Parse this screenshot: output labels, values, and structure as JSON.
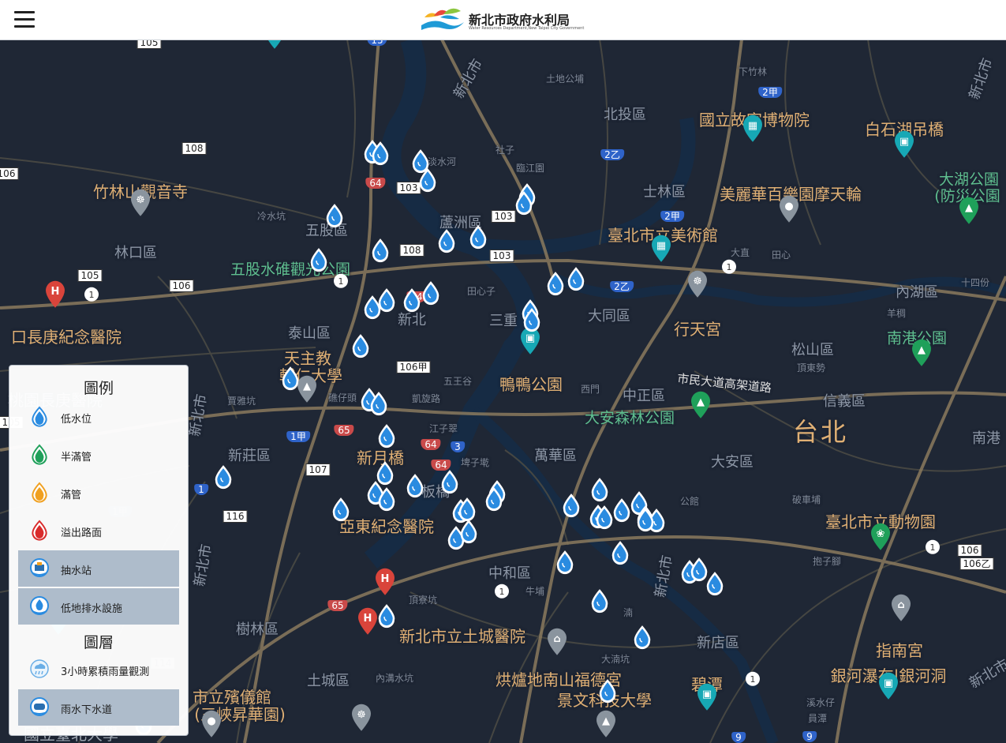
{
  "header": {
    "title": "新北市政府水利局",
    "subtitle": "Water Resources Department,New Taipei City Government"
  },
  "legend": {
    "title": "圖例",
    "items": [
      {
        "label": "低水位",
        "color": "#2a8be0",
        "active": false
      },
      {
        "label": "半滿管",
        "color": "#1fa05a",
        "active": false
      },
      {
        "label": "滿管",
        "color": "#f0a020",
        "active": false
      },
      {
        "label": "溢出路面",
        "color": "#d92b2b",
        "active": false
      },
      {
        "label": "抽水站",
        "color": "#2a8be0",
        "active": true
      },
      {
        "label": "低地排水設施",
        "color": "#2a8be0",
        "active": true
      }
    ],
    "layers_title": "圖層",
    "layers": [
      {
        "label": "3小時累積雨量觀測",
        "active": false
      },
      {
        "label": "雨水下水道",
        "active": true
      }
    ]
  },
  "map": {
    "places": [
      {
        "text": "竹林山觀音寺"
      },
      {
        "text": "口長庚紀念醫院"
      },
      {
        "text": "天主教"
      },
      {
        "text": "輔仁大學"
      },
      {
        "text": "桃園長庚醫院"
      },
      {
        "text": "新月橋"
      },
      {
        "text": "亞東紀念醫院"
      },
      {
        "text": "新北市立土城醫院"
      },
      {
        "text": "市立殯儀館"
      },
      {
        "text": "(三峽昇華園)"
      },
      {
        "text": "烘爐地南山福德宮"
      },
      {
        "text": "景文科技大學"
      },
      {
        "text": "碧潭"
      },
      {
        "text": "鴨鴨公園"
      },
      {
        "text": "國立故宮博物院"
      },
      {
        "text": "白石湖吊橋"
      },
      {
        "text": "美麗華百樂園摩天輪"
      },
      {
        "text": "臺北市立美術館"
      },
      {
        "text": "行天宮"
      },
      {
        "text": "臺北市立動物園"
      },
      {
        "text": "指南宮"
      },
      {
        "text": "銀河瀑布|銀河洞"
      },
      {
        "text": "國立臺北大學"
      },
      {
        "text": "市民大道高架道路"
      }
    ],
    "parks": [
      {
        "text": "五股水碓觀光公園"
      },
      {
        "text": "大安森林公園"
      },
      {
        "text": "南港公園"
      },
      {
        "text": "大湖公園"
      },
      {
        "text": "(防災公園"
      }
    ],
    "districts": [
      {
        "text": "蘆洲區"
      },
      {
        "text": "林口區"
      },
      {
        "text": "泰山區"
      },
      {
        "text": "新莊區"
      },
      {
        "text": "樹林區"
      },
      {
        "text": "土城區"
      },
      {
        "text": "中和區"
      },
      {
        "text": "萬華區"
      },
      {
        "text": "大同區"
      },
      {
        "text": "中正區"
      },
      {
        "text": "大安區"
      },
      {
        "text": "信義區"
      },
      {
        "text": "松山區"
      },
      {
        "text": "內湖區"
      },
      {
        "text": "士林區"
      },
      {
        "text": "北投區"
      },
      {
        "text": "新店區"
      },
      {
        "text": "五股區"
      },
      {
        "text": "三重"
      },
      {
        "text": "新北"
      },
      {
        "text": "板橋"
      },
      {
        "text": "新北市"
      },
      {
        "text": "南港"
      },
      {
        "text": "新北市"
      },
      {
        "text": "新北市"
      },
      {
        "text": "新北市"
      },
      {
        "text": "新北市"
      },
      {
        "text": "新北市"
      }
    ],
    "small_places": [
      {
        "text": "土地公埔"
      },
      {
        "text": "下竹林"
      },
      {
        "text": "淡水河"
      },
      {
        "text": "社子"
      },
      {
        "text": "臨江園"
      },
      {
        "text": "冷水坑"
      },
      {
        "text": "田心子"
      },
      {
        "text": "大直"
      },
      {
        "text": "田心"
      },
      {
        "text": "十四份"
      },
      {
        "text": "羊稠"
      },
      {
        "text": "頂東勢"
      },
      {
        "text": "五王谷"
      },
      {
        "text": "凱旋路"
      },
      {
        "text": "礁仔頭"
      },
      {
        "text": "賈雅坑"
      },
      {
        "text": "江子翠"
      },
      {
        "text": "埤子墘"
      },
      {
        "text": "西門"
      },
      {
        "text": "公館"
      },
      {
        "text": "破車埔"
      },
      {
        "text": "抱子腳"
      },
      {
        "text": "牛埔"
      },
      {
        "text": "頂寮坑"
      },
      {
        "text": "內溝水坑"
      },
      {
        "text": "大湳坑"
      },
      {
        "text": "溪水仔"
      },
      {
        "text": "員潭"
      },
      {
        "text": "湳"
      }
    ],
    "shields": [
      {
        "text": "105"
      },
      {
        "text": "108"
      },
      {
        "text": "106"
      },
      {
        "text": "105"
      },
      {
        "text": "106"
      },
      {
        "text": "103"
      },
      {
        "text": "103"
      },
      {
        "text": "108"
      },
      {
        "text": "103"
      },
      {
        "text": "106甲"
      },
      {
        "text": "107"
      },
      {
        "text": "116"
      },
      {
        "text": "106"
      },
      {
        "text": "106乙"
      },
      {
        "text": "105"
      },
      {
        "text": "64"
      },
      {
        "text": "64"
      },
      {
        "text": "65"
      },
      {
        "text": "64"
      },
      {
        "text": "64"
      },
      {
        "text": "65"
      },
      {
        "text": "2甲"
      },
      {
        "text": "2乙"
      },
      {
        "text": "2甲"
      },
      {
        "text": "2乙"
      },
      {
        "text": "1甲"
      },
      {
        "text": "3"
      },
      {
        "text": "1"
      },
      {
        "text": "15"
      },
      {
        "text": "9"
      },
      {
        "text": "9"
      },
      {
        "text": "1甲"
      },
      {
        "text": "114"
      }
    ],
    "sensor_count": 56
  },
  "colors": {
    "map_bg": "#1f2735",
    "road": "#5c5548",
    "major_road": "#8a7a5e",
    "river": "#162b44",
    "sensor_blue": "#2a8be0",
    "poi_teal": "#17a8b5",
    "poi_grey": "#8a949e",
    "poi_red": "#d9443b",
    "poi_green": "#1fa05a"
  }
}
